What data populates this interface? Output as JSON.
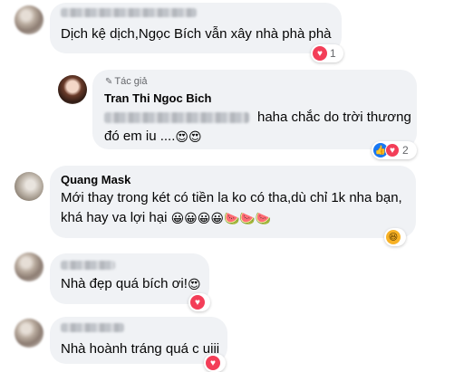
{
  "colors": {
    "bubble": "#f0f2f5",
    "love": "#f33e58",
    "like": "#1877f2",
    "haha": "#f7b125",
    "muted": "#65676b"
  },
  "comments": [
    {
      "id": "c1",
      "name_hidden": true,
      "text_lines": [
        "Dịch kệ dịch,Ngọc Bích vẫn xây nhà phà phà"
      ],
      "reactions": {
        "icons": [
          "love-icon"
        ],
        "count": "1"
      }
    },
    {
      "id": "c2",
      "author_badge": "Tác giả",
      "name": "Tran Thi Ngoc Bich",
      "text_lines": [
        "haha chắc do trời thương",
        "đó em iu ...."
      ],
      "emoji_after_line2": "😍😍",
      "reactions": {
        "icons": [
          "like-icon",
          "love-icon"
        ],
        "count": "2"
      }
    },
    {
      "id": "c3",
      "name": "Quang Mask",
      "text_lines": [
        "Mới thay trong két có tiền la ko có tha,dù chỉ 1k nha bạn,",
        "khá hay va lợi hại"
      ],
      "emoji_after_line2": "😀😀😀😀🍉🍉🍉",
      "reactions": {
        "icons": [
          "haha-icon"
        ],
        "count": ""
      }
    },
    {
      "id": "c4",
      "name_hidden": true,
      "text_lines": [
        "Nhà đẹp quá bích ơi!"
      ],
      "emoji_after_line1": "😍",
      "reactions": {
        "icons": [
          "love-icon"
        ],
        "count": ""
      }
    },
    {
      "id": "c5",
      "name_hidden": true,
      "text_lines": [
        "Nhà hoành tráng quá c uiii"
      ],
      "reactions": {
        "icons": [
          "love-icon"
        ],
        "count": ""
      }
    }
  ]
}
